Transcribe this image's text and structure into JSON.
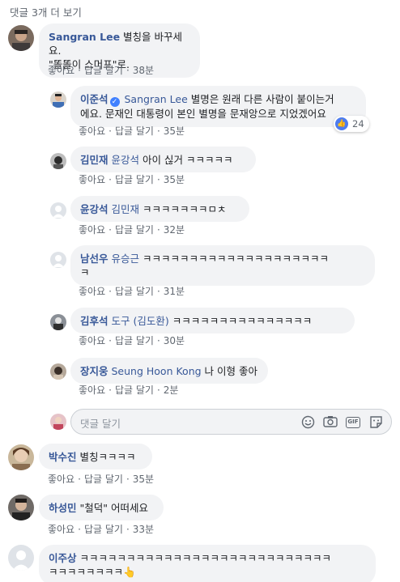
{
  "more_replies": "댓글 3개 더 보기",
  "actions": {
    "like": "좋아요",
    "reply": "답글 달기",
    "dot": "·"
  },
  "comments": [
    {
      "author": "Sangran Lee",
      "line1": "별칭을 바꾸세요.",
      "line2": "\"똘똘이 스머프\"로.",
      "time": "38분"
    },
    {
      "author": "이준석",
      "mention": "Sangran Lee",
      "line1": "별명은 원래 다른 사람이 붙이는거",
      "line2": "에요. 문재인 대통령이 본인 별명을 문재앙으로 지었겠어요",
      "time": "35분",
      "likes": "24"
    },
    {
      "author": "김민재",
      "mention": "윤강석",
      "text": "아이 싢거 ㅋㅋㅋㅋㅋ",
      "time": "35분"
    },
    {
      "author": "윤강석",
      "mention": "김민재",
      "text": "ㅋㅋㅋㅋㅋㅋㅋㅁㅊ",
      "time": "32분"
    },
    {
      "author": "남선우",
      "mention": "유승근",
      "line1": "ㅋㅋㅋㅋㅋㅋㅋㅋㅋㅋㅋㅋㅋㅋㅋㅋㅋㅋㅋㅋ",
      "line2": "ㅋ",
      "time": "31분"
    },
    {
      "author": "김후석",
      "mention": "도구 (김도환)",
      "text": "ㅋㅋㅋㅋㅋㅋㅋㅋㅋㅋㅋㅋㅋㅋㅋ",
      "time": "30분"
    },
    {
      "author": "장지웅",
      "mention": "Seung Hoon Kong",
      "text": "나 이형 좋아",
      "time": "2분"
    },
    {
      "author": "박수진",
      "text": "별칭ㅋㅋㅋㅋ",
      "time": "35분"
    },
    {
      "author": "하성민",
      "text": "\"철덕\" 어떠세요",
      "time": "33분"
    },
    {
      "author": "이주상",
      "line1": "ㅋㅋㅋㅋㅋㅋㅋㅋㅋㅋㅋㅋㅋㅋㅋㅋㅋㅋㅋㅋㅋㅋㅋㅋㅋㅋㅋ",
      "line2": "ㅋㅋㅋㅋㅋㅋㅋㅋ👆"
    }
  ],
  "reply_box": {
    "placeholder": "댓글 달기"
  },
  "icons": [
    "smiley-icon",
    "camera-icon",
    "gif-icon",
    "sticker-icon"
  ],
  "colors": {
    "author": "#385898",
    "bubble": "#f2f3f5",
    "meta": "#606770",
    "like_badge": "#4d7cf0"
  }
}
